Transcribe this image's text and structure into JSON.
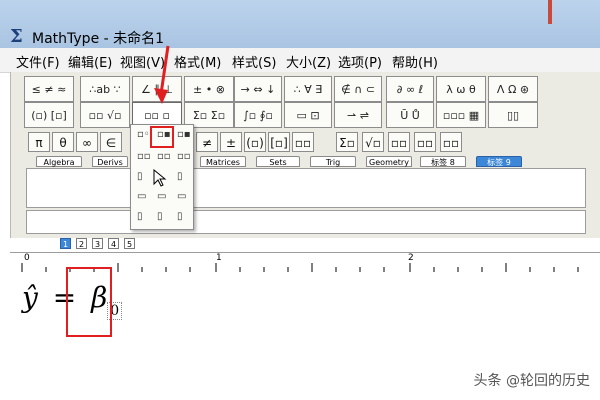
{
  "window": {
    "app_icon": "Σ",
    "title": "MathType - 未命名1"
  },
  "menu": [
    "文件(F)",
    "编辑(E)",
    "视图(V)",
    "格式(M)",
    "样式(S)",
    "大小(Z)",
    "选项(P)",
    "帮助(H)"
  ],
  "palettes_row1": [
    "≤ ≠ ≈",
    "∴ab ∵",
    "∠ ∥ ⊥",
    "± • ⊗",
    "→ ⇔ ↓",
    "∴ ∀ ∃",
    "∉ ∩ ⊂",
    "∂ ∞ ℓ",
    "λ ω θ",
    "Λ Ω ⊛"
  ],
  "palettes_row2": [
    "(▫) [▫]",
    "▫▫ √▫",
    "▫▫ ▫",
    "Σ▫ Σ▫",
    "∫▫ ∮▫",
    "▭ ⊡",
    "⇀ ⇌",
    "Ū Ů",
    "▫▫▫ ▦",
    "▯▯"
  ],
  "symbols_row": [
    "π",
    "θ",
    "∞",
    "∈",
    "≠",
    "±",
    "(▫)",
    "[▫]",
    "▫▫",
    "Σ▫",
    "√▫",
    "▫▫",
    "▫▫",
    "▫▫"
  ],
  "category_tabs": [
    "Algebra",
    "Derivs",
    "Matrices",
    "Sets",
    "Trig",
    "Geometry",
    "标签 8",
    "标签 9"
  ],
  "active_tab": "标签 9",
  "size_tabs": [
    "1",
    "2",
    "3",
    "4",
    "5"
  ],
  "ruler_marks": [
    "0",
    "1",
    "2"
  ],
  "equation": {
    "lhs": "ŷ",
    "equals": "=",
    "beta": "β",
    "subscript_box": "0"
  },
  "watermark": "头条 @轮回的历史",
  "colors": {
    "accent_red": "#e02020",
    "tab_active": "#3c87d8",
    "titlebar": "#b6cfea"
  }
}
